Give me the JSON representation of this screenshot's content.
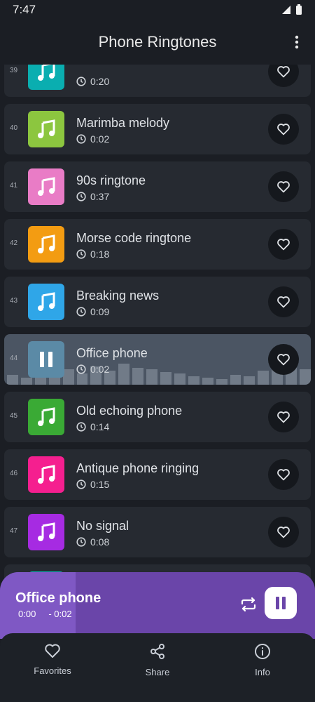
{
  "status_bar": {
    "time": "7:47"
  },
  "app_bar": {
    "title": "Phone Ringtones"
  },
  "rows": [
    {
      "num": "39",
      "title": "",
      "duration": "0:20",
      "color": "#0aaeb0"
    },
    {
      "num": "40",
      "title": "Marimba melody",
      "duration": "0:02",
      "color": "#8cc63f"
    },
    {
      "num": "41",
      "title": "90s ringtone",
      "duration": "0:37",
      "color": "#e97cc6"
    },
    {
      "num": "42",
      "title": "Morse code ringtone",
      "duration": "0:18",
      "color": "#f39c12"
    },
    {
      "num": "43",
      "title": "Breaking news",
      "duration": "0:09",
      "color": "#2fa6e8"
    },
    {
      "num": "44",
      "title": "Office phone",
      "duration": "0:02",
      "color": "#5b8aa6",
      "active": true
    },
    {
      "num": "45",
      "title": "Old echoing phone",
      "duration": "0:14",
      "color": "#3aaa35"
    },
    {
      "num": "46",
      "title": "Antique phone ringing",
      "duration": "0:15",
      "color": "#f51f8f"
    },
    {
      "num": "47",
      "title": "No signal",
      "duration": "0:08",
      "color": "#a62be2"
    },
    {
      "num": "",
      "title": "",
      "duration": "",
      "color": "#0aaeb0"
    }
  ],
  "player": {
    "title": "Office phone",
    "elapsed": "0:00",
    "remaining": "- 0:02",
    "progress": 0.24
  },
  "bottom_nav": {
    "favorites": "Favorites",
    "share": "Share",
    "info": "Info"
  }
}
